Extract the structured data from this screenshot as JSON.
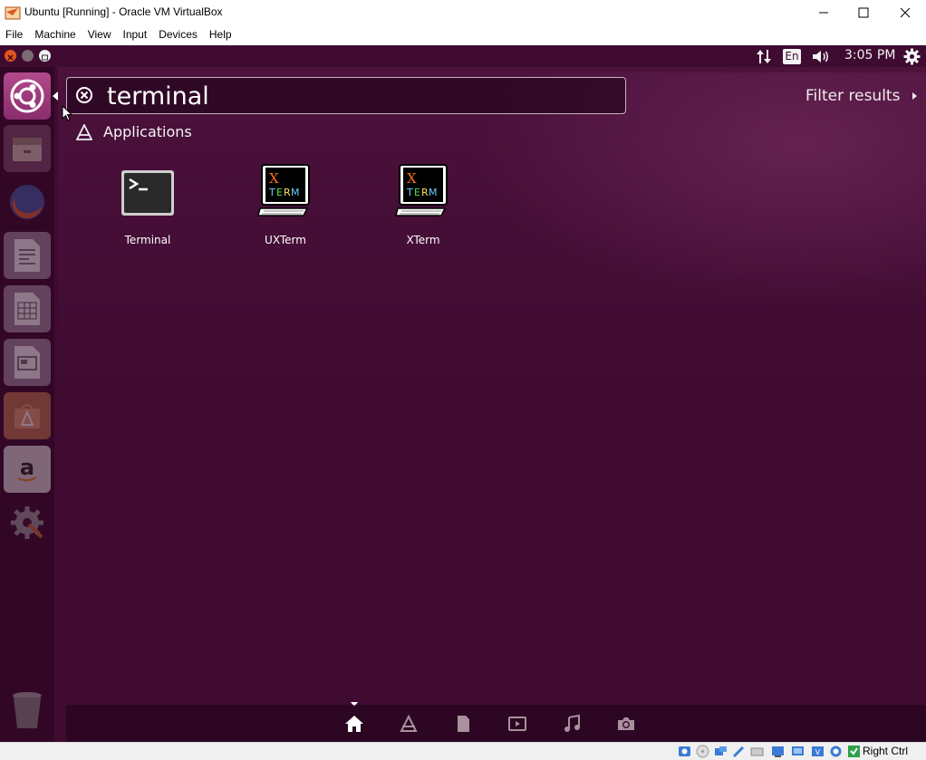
{
  "window": {
    "title": "Ubuntu [Running] - Oracle VM VirtualBox",
    "menu": [
      "File",
      "Machine",
      "View",
      "Input",
      "Devices",
      "Help"
    ]
  },
  "panel": {
    "keyboard_layout": "En",
    "clock": "3:05 PM",
    "icons": [
      "network-updown-icon",
      "volume-icon",
      "system-gear-icon"
    ]
  },
  "launcher": {
    "items": [
      "ubuntu-dash-icon",
      "files-icon",
      "firefox-icon",
      "writer-icon",
      "calc-icon",
      "impress-icon",
      "software-center-icon",
      "amazon-icon",
      "system-settings-icon",
      "trash-icon"
    ]
  },
  "dash": {
    "search_value": "terminal",
    "filter_label": "Filter results",
    "category": "Applications",
    "results": [
      {
        "label": "Terminal",
        "icon": "terminal-icon"
      },
      {
        "label": "UXTerm",
        "icon": "xterm-icon"
      },
      {
        "label": "XTerm",
        "icon": "xterm-icon"
      }
    ],
    "lenses": [
      "home-lens-icon",
      "applications-lens-icon",
      "files-lens-icon",
      "video-lens-icon",
      "music-lens-icon",
      "photos-lens-icon"
    ]
  },
  "statusbar": {
    "host_key": "Right Ctrl"
  },
  "colors": {
    "desktop": "#3f0b31",
    "accent": "#dd4814"
  }
}
